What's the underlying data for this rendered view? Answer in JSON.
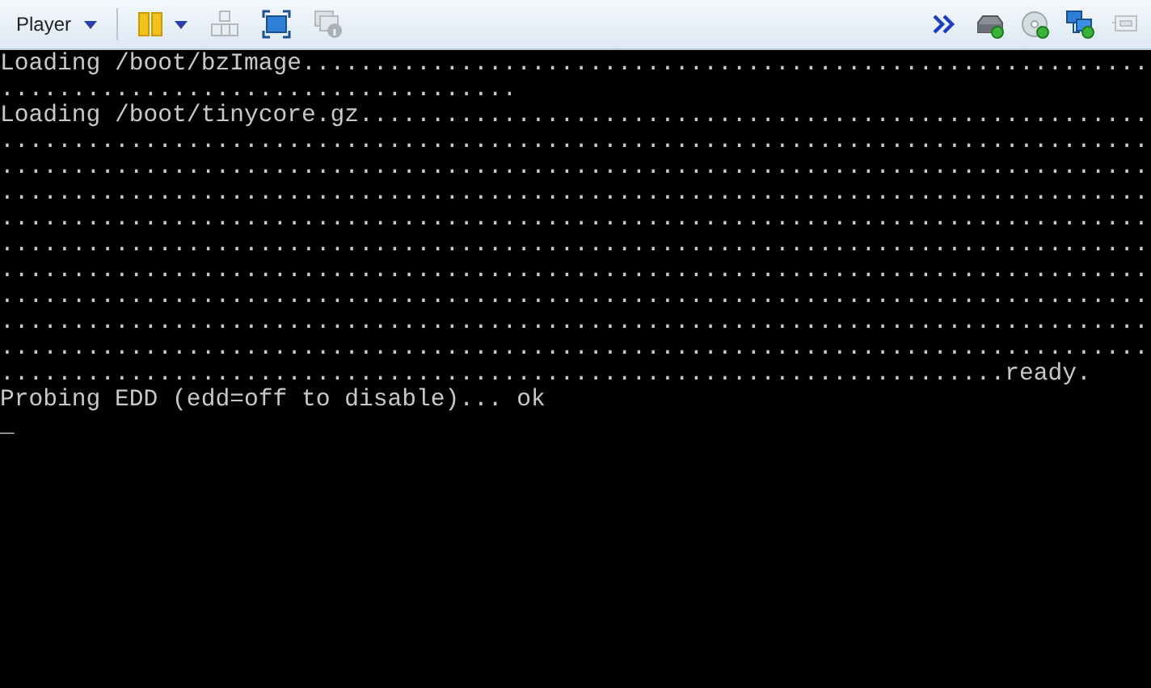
{
  "toolbar": {
    "menu": {
      "label": "Player"
    },
    "left_tools": [
      {
        "kind": "pause",
        "disabled": false,
        "dropdown": true
      },
      {
        "kind": "keys",
        "disabled": true,
        "dropdown": false
      },
      {
        "kind": "fullscreen",
        "disabled": false,
        "dropdown": false
      },
      {
        "kind": "unity",
        "disabled": true,
        "dropdown": false
      }
    ],
    "devices": [
      {
        "kind": "overflow",
        "disabled": false
      },
      {
        "kind": "disk",
        "disabled": false
      },
      {
        "kind": "cd",
        "disabled": false
      },
      {
        "kind": "network",
        "disabled": false
      },
      {
        "kind": "usb",
        "disabled": true
      }
    ]
  },
  "console": {
    "lines": [
      "Loading /boot/bzImage...........................................................",
      "....................................",
      "Loading /boot/tinycore.gz.......................................................",
      "................................................................................",
      "................................................................................",
      "................................................................................",
      "................................................................................",
      "................................................................................",
      "................................................................................",
      "................................................................................",
      "................................................................................",
      "................................................................................",
      "......................................................................ready.",
      "Probing EDD (edd=off to disable)... ok",
      "_"
    ]
  }
}
